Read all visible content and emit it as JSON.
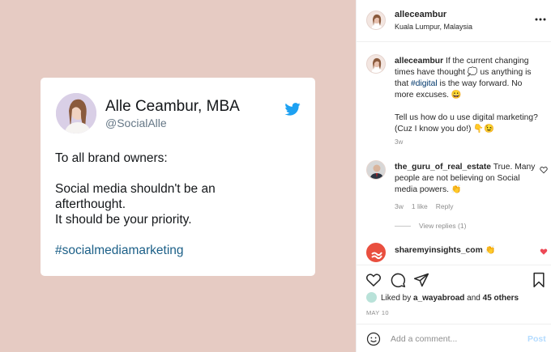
{
  "tweet": {
    "name": "Alle Ceambur, MBA",
    "handle": "@SocialAlle",
    "lines": [
      "To all brand owners:",
      "Social media shouldn't be an\nafterthought.\nIt should be your priority."
    ],
    "hashtag": "#socialmediamarketing"
  },
  "header": {
    "username": "alleceambur",
    "location": "Kuala Lumpur, Malaysia"
  },
  "caption": {
    "username": "alleceambur",
    "text_1": " If the current changing times have thought 💭 us anything is that ",
    "hashtag": "#digital",
    "text_2": " is the way forward. No more excuses. 😀",
    "text_3": "Tell us how do u use digital marketing? (Cuz I know you do!) 👇😉",
    "time": "3w"
  },
  "comments": [
    {
      "username": "the_guru_of_real_estate",
      "text": " True. Many people are not believing on Social media powers. 👏",
      "time": "3w",
      "likes": "1 like",
      "reply": "Reply",
      "view_replies": "View replies (1)"
    },
    {
      "username": "sharemyinsights_com",
      "text": " 👏"
    }
  ],
  "actions": {
    "liked_by_prefix": "Liked by ",
    "liked_by_user": "a_wayabroad",
    "liked_by_mid": " and ",
    "liked_by_others": "45 others",
    "date": "MAY 10"
  },
  "comment_box": {
    "placeholder": "Add a comment...",
    "post": "Post"
  },
  "colors": {
    "image_bg": "#e6cbc3",
    "twitter_blue": "#1da1f2",
    "like_red": "#ed4956",
    "link": "#00376b"
  },
  "icons": [
    "twitter-icon",
    "more-icon",
    "heart-icon",
    "comment-icon",
    "share-icon",
    "bookmark-icon",
    "smile-icon"
  ]
}
